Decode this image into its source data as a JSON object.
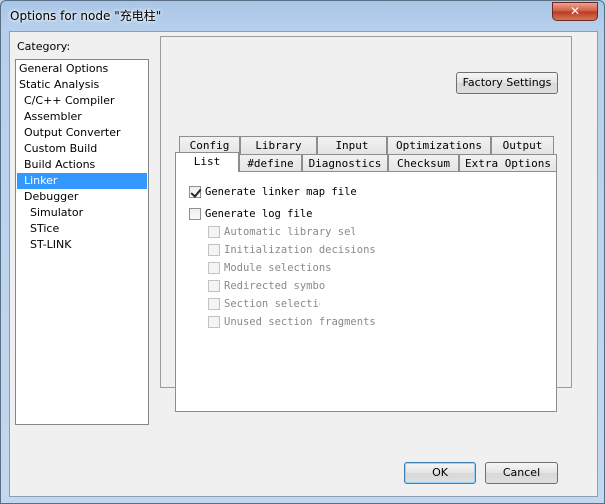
{
  "window": {
    "title": "Options for node \"充电柱\"",
    "close_glyph": "✕"
  },
  "category": {
    "label": "Category:",
    "items": [
      {
        "label": "General Options"
      },
      {
        "label": "Static Analysis"
      },
      {
        "label": "C/C++ Compiler"
      },
      {
        "label": "Assembler"
      },
      {
        "label": "Output Converter"
      },
      {
        "label": "Custom Build"
      },
      {
        "label": "Build Actions"
      },
      {
        "label": "Linker"
      },
      {
        "label": "Debugger"
      },
      {
        "label": "Simulator"
      },
      {
        "label": "STice"
      },
      {
        "label": "ST-LINK"
      }
    ],
    "selected": "Linker"
  },
  "factory_settings_label": "Factory Settings",
  "tabs": {
    "back_row": [
      "Config",
      "Library",
      "Input",
      "Optimizations",
      "Output"
    ],
    "front_row": [
      "List",
      "#define",
      "Diagnostics",
      "Checksum",
      "Extra Options"
    ],
    "active": "List"
  },
  "list_options": [
    {
      "label": "Generate linker map file",
      "checked": true,
      "enabled": true
    },
    {
      "label": "Generate log file",
      "checked": false,
      "enabled": true
    },
    {
      "label": "Automatic library selection",
      "checked": false,
      "enabled": false
    },
    {
      "label": "Initialization decisions",
      "checked": false,
      "enabled": false
    },
    {
      "label": "Module selections",
      "checked": false,
      "enabled": false
    },
    {
      "label": "Redirected symbols",
      "checked": false,
      "enabled": false
    },
    {
      "label": "Section selection",
      "checked": false,
      "enabled": false
    },
    {
      "label": "Unused section fragments",
      "checked": false,
      "enabled": false
    }
  ],
  "buttons": {
    "ok": "OK",
    "cancel": "Cancel"
  },
  "colors": {
    "selection": "#3399ff",
    "title_bar": "#b7d0ec"
  }
}
